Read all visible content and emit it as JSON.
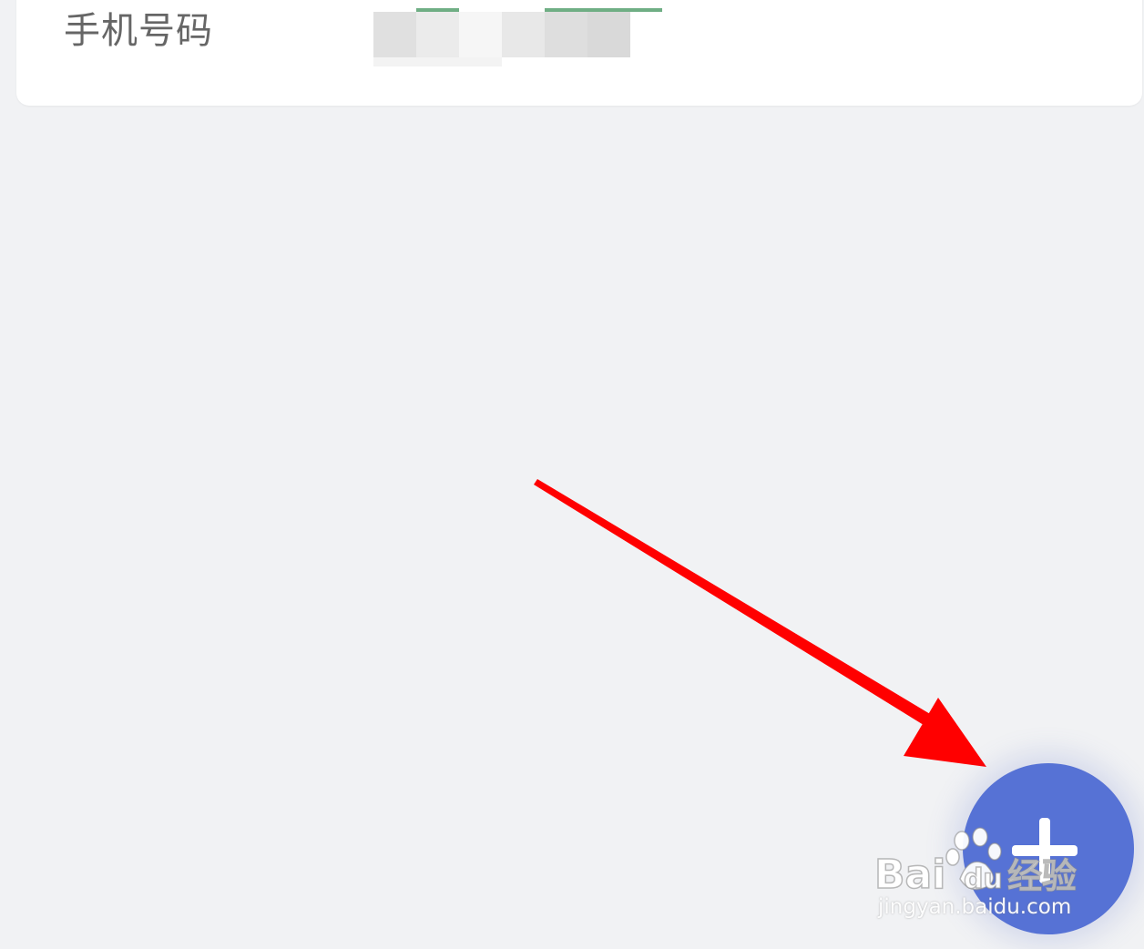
{
  "contact_field": {
    "label": "手机号码"
  },
  "fab": {
    "icon": "plus-icon",
    "color": "#5672d5"
  },
  "annotation": {
    "arrow_color": "#ff0000"
  },
  "watermark": {
    "logo_text": "Bai du 经验",
    "url": "jingyan.baidu.com"
  },
  "colors": {
    "background": "#f1f2f4",
    "card": "#ffffff",
    "label": "#666666",
    "accent_green": "#6fae84"
  }
}
